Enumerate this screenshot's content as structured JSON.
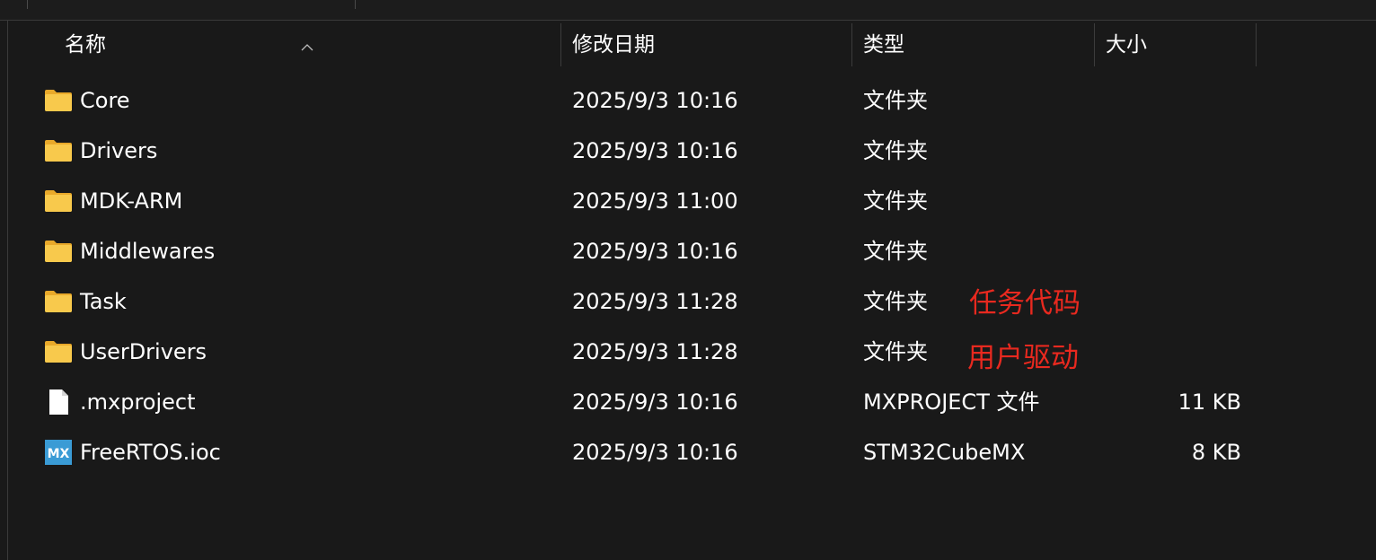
{
  "columns": {
    "name": "名称",
    "date": "修改日期",
    "type": "类型",
    "size": "大小"
  },
  "rows": [
    {
      "name": "Core",
      "date": "2025/9/3 10:16",
      "type": "文件夹",
      "size": "",
      "icon": "folder-icon"
    },
    {
      "name": "Drivers",
      "date": "2025/9/3 10:16",
      "type": "文件夹",
      "size": "",
      "icon": "folder-icon"
    },
    {
      "name": "MDK-ARM",
      "date": "2025/9/3 11:00",
      "type": "文件夹",
      "size": "",
      "icon": "folder-icon"
    },
    {
      "name": "Middlewares",
      "date": "2025/9/3 10:16",
      "type": "文件夹",
      "size": "",
      "icon": "folder-icon"
    },
    {
      "name": "Task",
      "date": "2025/9/3 11:28",
      "type": "文件夹",
      "size": "",
      "icon": "folder-icon"
    },
    {
      "name": "UserDrivers",
      "date": "2025/9/3 11:28",
      "type": "文件夹",
      "size": "",
      "icon": "folder-icon"
    },
    {
      "name": ".mxproject",
      "date": "2025/9/3 10:16",
      "type": "MXPROJECT 文件",
      "size": "11 KB",
      "icon": "file-icon"
    },
    {
      "name": "FreeRTOS.ioc",
      "date": "2025/9/3 10:16",
      "type": "STM32CubeMX",
      "size": "8 KB",
      "icon": "mx-icon"
    }
  ],
  "mx_icon_text": "MX",
  "annotations": {
    "task": "任务代码",
    "userdrivers": "用户驱动"
  },
  "colors": {
    "background": "#191919",
    "folder": "#f6c343",
    "annotation": "#e8291f",
    "mx_icon": "#3a9bd5"
  }
}
